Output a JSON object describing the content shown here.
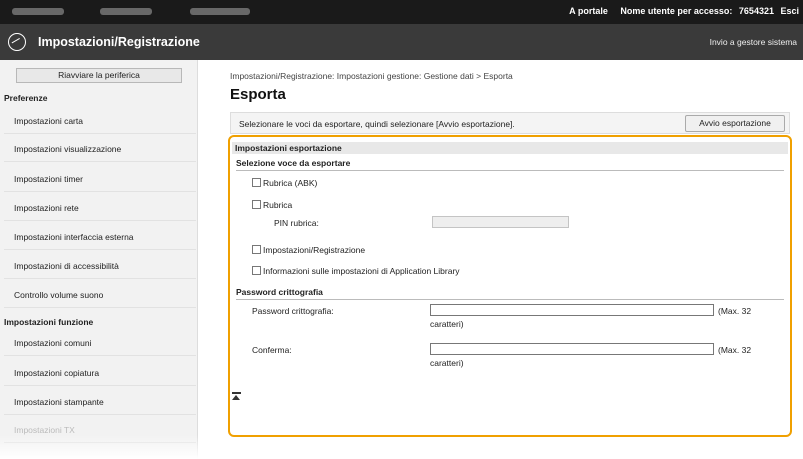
{
  "topbar": {
    "portal_link": "A portale",
    "user_label": "Nome utente per accesso:",
    "user_id": "7654321",
    "logout": "Esci"
  },
  "titlebar": {
    "title": "Impostazioni/Registrazione",
    "to_manager": "Invio a gestore sistema"
  },
  "sidebar": {
    "restart_button": "Riavviare la periferica",
    "preferences_heading": "Preferenze",
    "preferences_items": [
      "Impostazioni carta",
      "Impostazioni visualizzazione",
      "Impostazioni timer",
      "Impostazioni rete",
      "Impostazioni interfaccia esterna",
      "Impostazioni di accessibilità",
      "Controllo volume suono"
    ],
    "function_heading": "Impostazioni funzione",
    "function_items": [
      "Impostazioni comuni",
      "Impostazioni copiatura",
      "Impostazioni stampante",
      "Impostazioni TX"
    ]
  },
  "main": {
    "breadcrumb": "Impostazioni/Registrazione: Impostazioni gestione: Gestione dati > Esporta",
    "page_title": "Esporta",
    "instruction": "Selezionare le voci da esportare, quindi selezionare [Avvio esportazione].",
    "start_button": "Avvio esportazione",
    "panel_title": "Impostazioni esportazione",
    "section_items_title": "Selezione voce da esportare",
    "items": {
      "abk": "Rubrica (ABK)",
      "addressbook": "Rubrica",
      "pin_label": "PIN rubrica:",
      "settings": "Impostazioni/Registrazione",
      "app_library": "Informazioni sulle impostazioni di Application Library"
    },
    "section_password_title": "Password crittografia",
    "password_label": "Password crittografia:",
    "confirm_label": "Conferma:",
    "max_hint": "(Max. 32",
    "max_hint_unit": "caratteri)"
  }
}
